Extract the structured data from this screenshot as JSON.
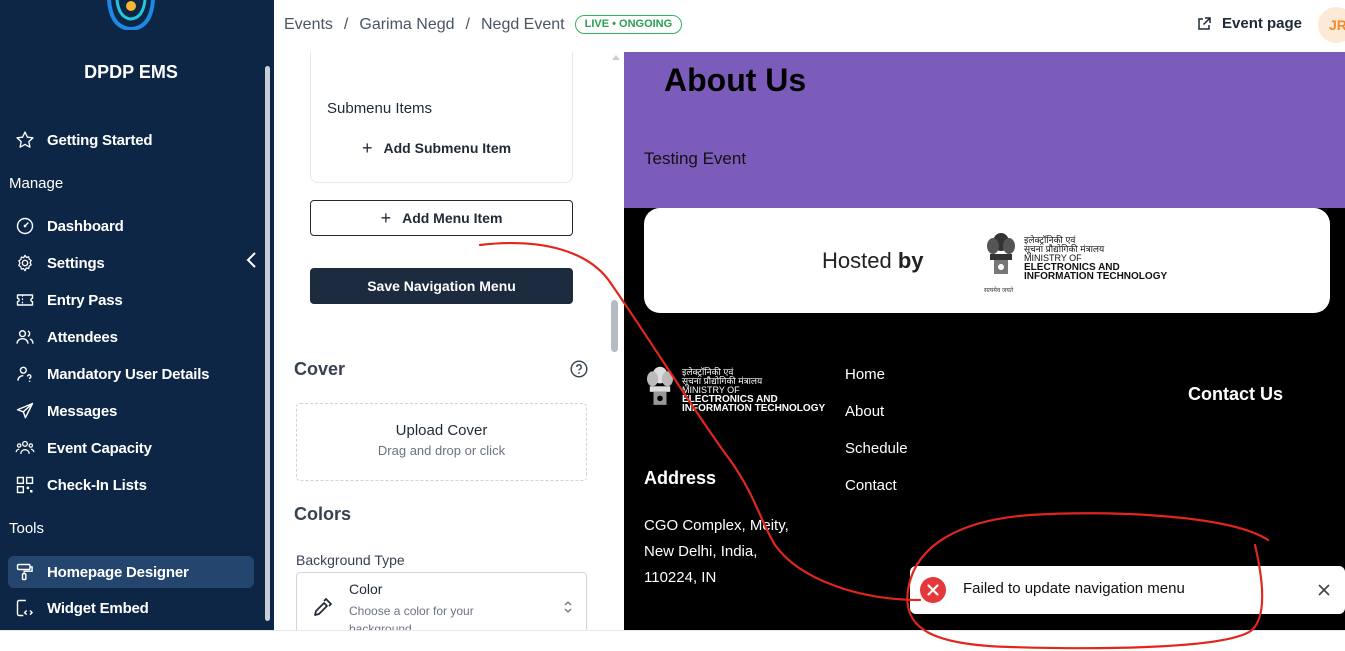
{
  "sidebar": {
    "brand": "DPDP EMS",
    "getting_started": "Getting Started",
    "section_manage": "Manage",
    "manage_items": [
      "Dashboard",
      "Settings",
      "Entry Pass",
      "Attendees",
      "Mandatory User Details",
      "Messages",
      "Event Capacity",
      "Check-In Lists"
    ],
    "section_tools": "Tools",
    "tool_items": [
      "Homepage Designer",
      "Widget Embed"
    ],
    "active_item": "Homepage Designer",
    "colors": {
      "bg": "#0d2646",
      "active_bg": "#24466e"
    }
  },
  "topbar": {
    "breadcrumb": [
      "Events",
      "Garima Negd",
      "Negd Event"
    ],
    "separator": "/",
    "status_badge": "LIVE • ONGOING",
    "event_page": "Event page",
    "avatar_initials": "JR"
  },
  "editor": {
    "submenu_items_label": "Submenu Items",
    "add_submenu_item": "Add Submenu Item",
    "add_menu_item": "Add Menu Item",
    "save_navigation_menu": "Save Navigation Menu",
    "cover_title": "Cover",
    "upload_cover": "Upload Cover",
    "upload_hint": "Drag and drop or click",
    "colors_title": "Colors",
    "background_type_label": "Background Type",
    "background_type_value": "Color",
    "background_type_desc": "Choose a color for your background"
  },
  "preview": {
    "about_title": "About Us",
    "about_text": "Testing Event",
    "hosted_prefix": "Hosted ",
    "hosted_by": "by",
    "ministry_hindi_1": "इलेक्ट्रॉनिकी एवं",
    "ministry_hindi_2": "सूचना प्रौद्योगिकी मंत्रालय",
    "ministry_en_1": "MINISTRY OF",
    "ministry_en_2": "ELECTRONICS AND",
    "ministry_en_3": "INFORMATION TECHNOLOGY",
    "emblem_motto": "सत्यमेव जयते",
    "footer_links": [
      "Home",
      "About",
      "Schedule",
      "Contact"
    ],
    "contact_us": "Contact Us",
    "address_title": "Address",
    "address_lines": [
      "CGO Complex, Meity,",
      "New Delhi, India,",
      "110224, IN"
    ],
    "colors": {
      "about_band": "#7c5cbb"
    }
  },
  "toast": {
    "message": "Failed to update navigation menu",
    "type": "error",
    "color": "#e5383b"
  },
  "annotation": {
    "color": "#e0261d",
    "shape": "hand-drawn line and circle"
  }
}
